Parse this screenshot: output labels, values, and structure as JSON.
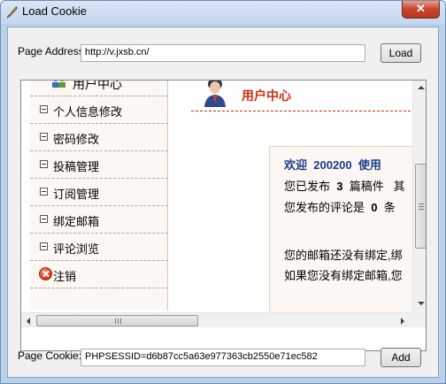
{
  "window": {
    "title": "Load Cookie",
    "close_glyph": "✕"
  },
  "page_address": {
    "label": "Page Address:",
    "value": "http://v.jxsb.cn/",
    "button": "Load"
  },
  "page_cookie": {
    "label": "Page Cookie:",
    "value": "PHPSESSID=d6b87cc5a63e977363cb2550e71ec582",
    "button": "Add"
  },
  "web": {
    "sidebar": {
      "heading": "用户中心",
      "items": [
        {
          "label": "个人信息修改"
        },
        {
          "label": "密码修改"
        },
        {
          "label": "投稿管理"
        },
        {
          "label": "订阅管理"
        },
        {
          "label": "绑定邮箱"
        },
        {
          "label": "评论浏览"
        }
      ],
      "logout": "注销"
    },
    "main": {
      "title": "用户中心",
      "welcome_prefix": "欢迎",
      "username": "200200",
      "welcome_suffix": "使用",
      "published_prefix": "您已发布",
      "published_count": "3",
      "published_suffix": "篇稿件",
      "published_tail": "其",
      "comments_prefix": "您发布的评论是",
      "comments_count": "0",
      "comments_suffix": "条",
      "email_line1": "您的邮箱还没有绑定,绑",
      "email_line2": "如果您没有绑定邮箱,您"
    }
  },
  "colors": {
    "accent_red": "#d32a0e",
    "welcome_blue": "#1a3c8a",
    "panel_bg": "#fdf7f3"
  },
  "icons": [
    "feather-icon",
    "close-icon",
    "users-icon",
    "avatar-icon",
    "logout-icon"
  ]
}
